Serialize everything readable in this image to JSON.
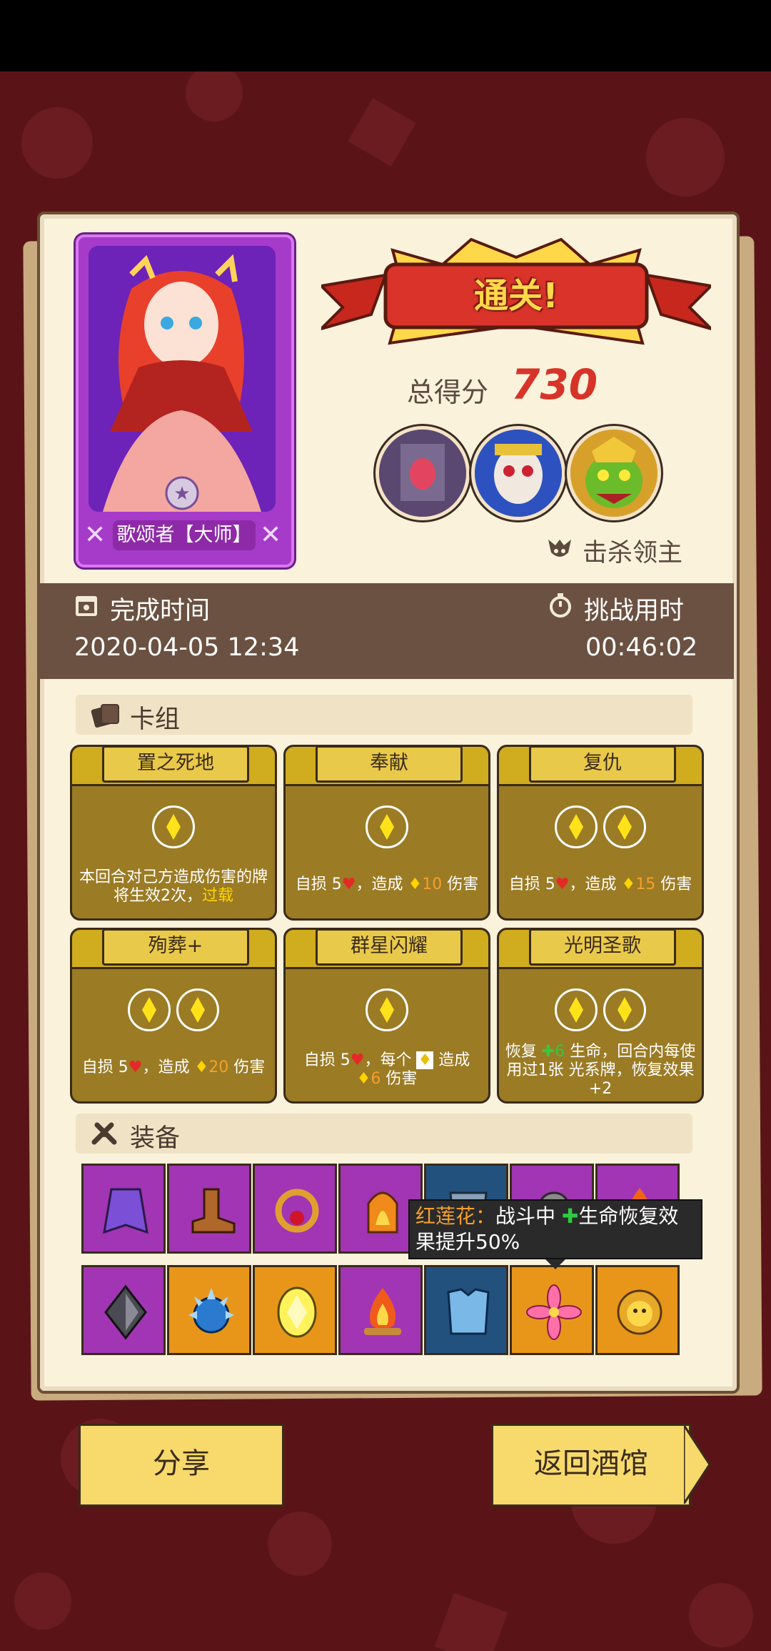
{
  "colors": {
    "bg": "#5a1418",
    "panel": "#fbf2dc",
    "time_bar": "#6b5141",
    "score": "#d73329",
    "card": "#9b7b24",
    "button": "#f7da6b"
  },
  "hero": {
    "name": "歌颂者【大师】",
    "icon": "hero-portrait-singer"
  },
  "result": {
    "banner": "通关!",
    "score_label": "总得分",
    "score_value": "730",
    "bosses": [
      "stone-golem-boss-icon",
      "painted-mask-boss-icon",
      "green-goblin-boss-icon"
    ],
    "boss_killed_label": "击杀领主"
  },
  "time": {
    "finish_label": "完成时间",
    "finish_value": "2020-04-05 12:34",
    "challenge_label": "挑战用时",
    "challenge_value": "00:46:02"
  },
  "deck": {
    "title": "卡组",
    "cards": [
      {
        "name": "置之死地",
        "gems": 1,
        "desc_parts": [
          "本回合对己方造成伤害的牌将生效2次，",
          "过载"
        ]
      },
      {
        "name": "奉献",
        "gems": 1,
        "desc_parts": [
          "自损 5",
          "，造成 ",
          "10",
          " 伤害"
        ]
      },
      {
        "name": "复仇",
        "gems": 2,
        "desc_parts": [
          "自损 5",
          "，造成 ",
          "15",
          " 伤害"
        ]
      },
      {
        "name": "殉葬+",
        "gems": 2,
        "desc_parts": [
          "自损 5",
          "，造成 ",
          "20",
          " 伤害"
        ]
      },
      {
        "name": "群星闪耀",
        "gems": 1,
        "desc_parts": [
          "自损 5",
          "，每个 ",
          "造成",
          "6",
          " 伤害"
        ]
      },
      {
        "name": "光明圣歌",
        "gems": 2,
        "desc_parts": [
          "恢复 ",
          "6",
          " 生命，回合内每使用过1张 ",
          "光系牌，恢复效果+2"
        ]
      }
    ]
  },
  "equipment": {
    "title": "装备",
    "row1": [
      "purple-cape-icon",
      "brown-boots-icon",
      "ruby-ring-icon",
      "flame-gauntlet-icon",
      "steel-armor-icon",
      "stone-helm-icon",
      "fire-charm-icon"
    ],
    "row2": [
      "dark-crystal-icon",
      "spiked-orb-icon",
      "yellow-gem-icon",
      "campfire-icon",
      "ice-armor-icon",
      "red-lotus-icon",
      "lion-ring-icon"
    ],
    "tooltip": {
      "name": "红莲花：",
      "line1": "战斗中 ",
      "line1b": "生命恢复效",
      "line2": "果提升50%"
    }
  },
  "buttons": {
    "share": "分享",
    "back": "返回酒馆"
  }
}
